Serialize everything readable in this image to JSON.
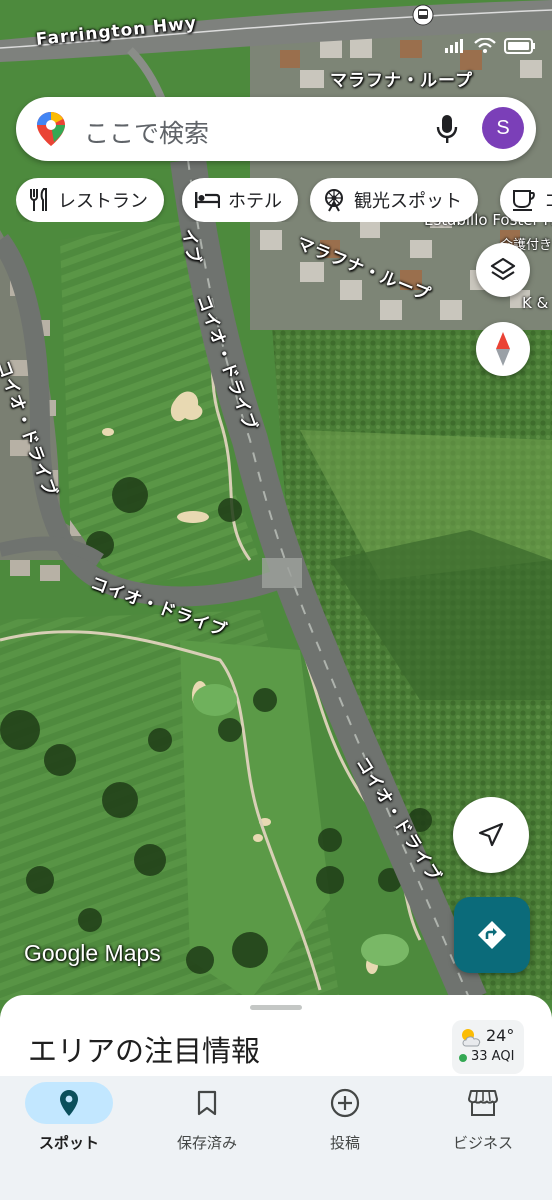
{
  "map": {
    "road_labels": [
      "Farrington Hwy",
      "マラフナ・ループ",
      "マラフナ・ループ",
      "コイオ・ドライブ",
      "コイオ・ドライブ",
      "コイオ・ドライブ",
      "コイオ・ドライブ",
      "イブ"
    ],
    "poi_labels": [
      "Estabillo Foster H",
      "介護付き",
      "K &"
    ],
    "attribution": "Google Maps"
  },
  "search": {
    "placeholder": "ここで検索",
    "avatar_letter": "S"
  },
  "chips": [
    {
      "label": "レストラン",
      "icon": "restaurant-icon"
    },
    {
      "label": "ホテル",
      "icon": "hotel-icon"
    },
    {
      "label": "観光スポット",
      "icon": "attraction-icon"
    },
    {
      "label": "コ",
      "icon": "coffee-icon"
    }
  ],
  "buttons": {
    "layers": "layers-icon",
    "compass": "compass-icon",
    "my_location": "navigation-arrow-icon",
    "directions": "directions-icon"
  },
  "sheet": {
    "title": "エリアの注目情報",
    "weather": {
      "temp": "24°",
      "aqi": "33 AQI",
      "aqi_color": "#34a853"
    }
  },
  "nav": [
    {
      "label": "スポット",
      "icon": "pin-icon",
      "active": true
    },
    {
      "label": "保存済み",
      "icon": "bookmark-icon",
      "active": false
    },
    {
      "label": "投稿",
      "icon": "add-circle-icon",
      "active": false
    },
    {
      "label": "ビジネス",
      "icon": "storefront-icon",
      "active": false
    }
  ],
  "colors": {
    "accent": "#0b6b7a",
    "avatar": "#7b3fb8",
    "nav_active_pill": "#c2e7ff"
  }
}
